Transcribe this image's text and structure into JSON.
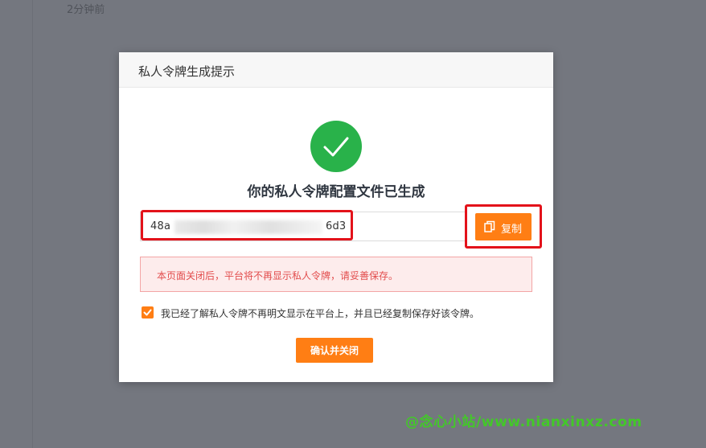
{
  "background": {
    "timestamp": "2分钟前"
  },
  "modal": {
    "title": "私人令牌生成提示",
    "success_message": "你的私人令牌配置文件已生成",
    "token_prefix": "48a",
    "token_suffix": "6d3",
    "copy_button_label": "复制",
    "warning": "本页面关闭后，平台将不再显示私人令牌，请妥善保存。",
    "acknowledge_label": "我已经了解私人令牌不再明文显示在平台上，并且已经复制保存好该令牌。",
    "acknowledge_checked": true,
    "confirm_button_label": "确认并关闭"
  },
  "watermark": "@念心小站/www.nianxinxz.com",
  "colors": {
    "accent": "#ff7e14",
    "success": "#29b24a",
    "highlight_box": "#e3121a",
    "warning_text": "#e24c4c",
    "watermark": "#43c829"
  },
  "icons": {
    "success": "check-circle-icon",
    "copy": "copy-icon",
    "checkbox": "checkmark-icon"
  }
}
